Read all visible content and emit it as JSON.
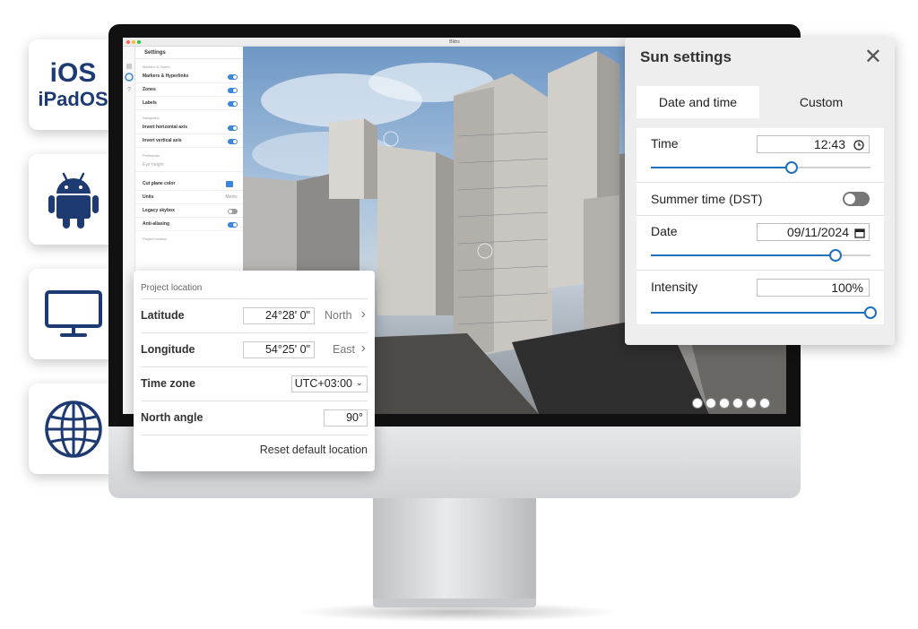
{
  "platforms": {
    "ios_line1": "iOS",
    "ios_line2": "iPadOS",
    "android_icon": "android-robot-icon",
    "desktop_icon": "monitor-icon",
    "web_icon": "globe-icon",
    "brand_color": "#1d3a73"
  },
  "app": {
    "window_title": "Bldrs"
  },
  "settings_sidebar": {
    "title": "Settings",
    "section_markers": "Markers & Zones",
    "markers_hyperlinks": "Markers & Hyperlinks",
    "zones": "Zones",
    "labels": "Labels",
    "section_navigation": "Navigation",
    "invert_horizontal": "Invert horizontal axis",
    "invert_vertical": "Invert vertical axis",
    "section_pedestrian": "Pedestrian",
    "eye_height": "Eye height",
    "cut_plane_color": "Cut plane color",
    "units": "Units",
    "units_value": "Metric",
    "legacy_skybox": "Legacy skybox",
    "anti_aliasing": "Anti-aliasing",
    "section_project": "Project location",
    "accent": "#3b86d8"
  },
  "sun_settings": {
    "title": "Sun settings",
    "close_icon": "close-icon",
    "tab_date_time": "Date and time",
    "tab_custom": "Custom",
    "time_label": "Time",
    "time_value": "12:43",
    "time_slider": 0.64,
    "dst_label": "Summer time (DST)",
    "dst_on": false,
    "date_label": "Date",
    "date_value": "09/11/2024",
    "date_slider": 0.84,
    "intensity_label": "Intensity",
    "intensity_value": "100%",
    "intensity_slider": 1.0,
    "accent": "#1f6fbf"
  },
  "project_location": {
    "heading": "Project location",
    "latitude_label": "Latitude",
    "latitude_value": "24°28'  0\"",
    "latitude_dir": "North",
    "longitude_label": "Longitude",
    "longitude_value": "54°25'  0\"",
    "longitude_dir": "East",
    "timezone_label": "Time zone",
    "timezone_value": "UTC+03:00",
    "north_angle_label": "North angle",
    "north_angle_value": "90°",
    "reset_label": "Reset default location"
  }
}
